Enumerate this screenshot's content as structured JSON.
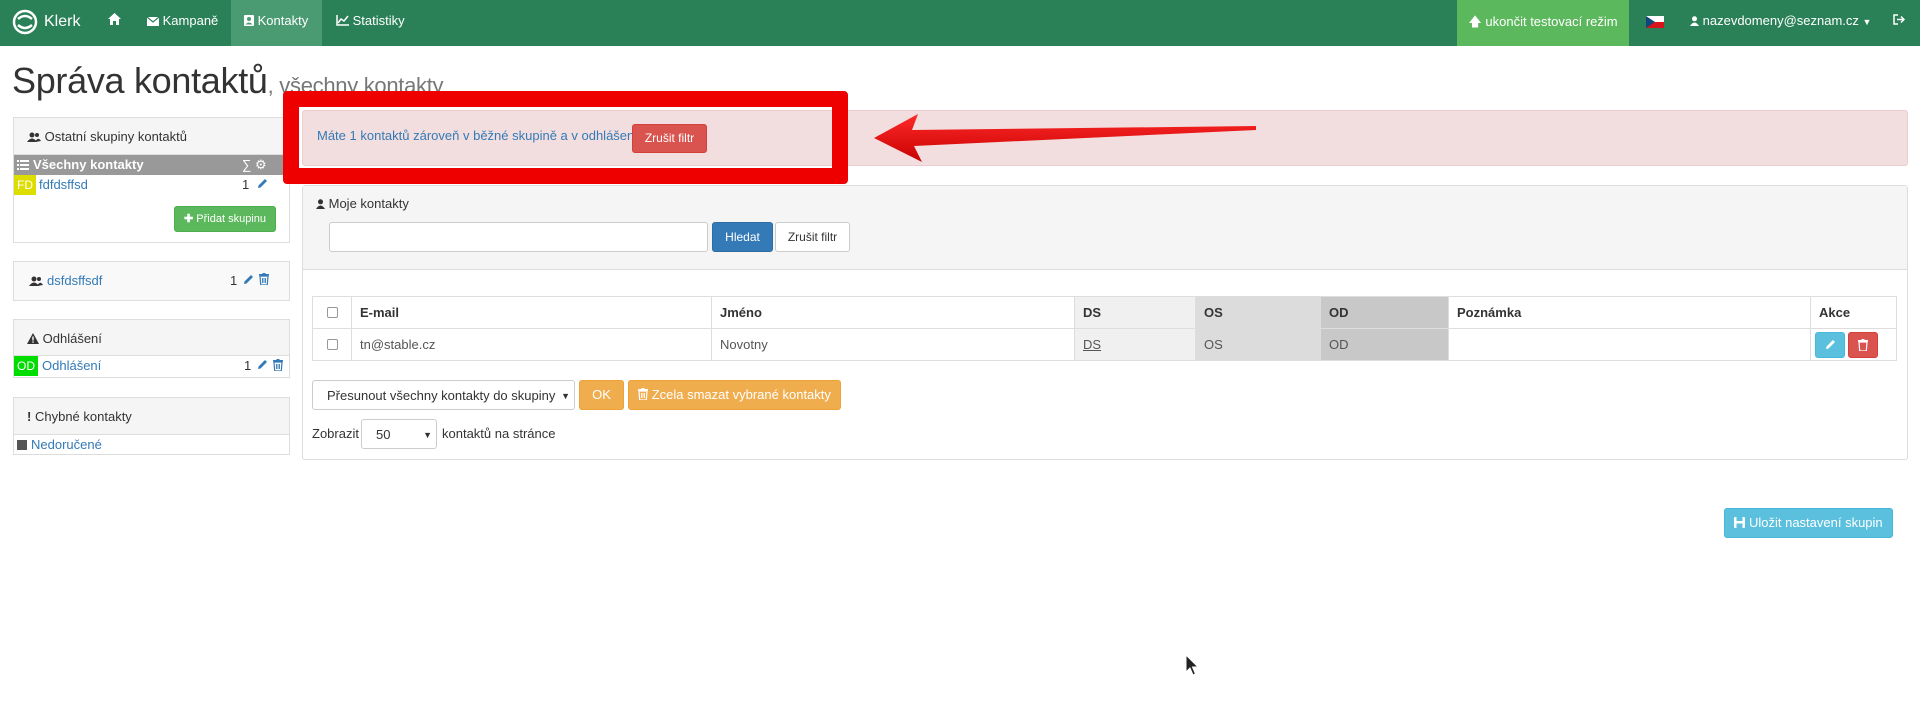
{
  "navbar": {
    "brand": "Klerk",
    "home_icon": "home-icon",
    "items": [
      {
        "label": "Kampaně",
        "icon": "envelope-icon"
      },
      {
        "label": "Kontakty",
        "icon": "address-book-icon",
        "active": true
      },
      {
        "label": "Statistiky",
        "icon": "line-chart-icon"
      }
    ],
    "test_mode_label": "ukončit testovací režim",
    "user_email": "nazevdomeny@seznam.cz",
    "colors": {
      "navbar": "#2a8057",
      "active": "#4a9a72",
      "test": "#5cb85c"
    }
  },
  "page": {
    "title": "Správa kontaktů",
    "subtitle": ", všechny kontakty"
  },
  "sidebar": {
    "other_groups": {
      "title": "Ostatní skupiny kontaktů",
      "all_label": "Všechny kontakty",
      "sum_symbol": "∑",
      "groups": [
        {
          "tag": "FD",
          "name": "fdfdsffsd",
          "count": "1"
        }
      ],
      "add_button": "Přidat skupinu"
    },
    "group_box": {
      "name": "dsfdsffsdf",
      "count": "1"
    },
    "unsubscribe": {
      "title": "Odhlášení",
      "groups": [
        {
          "tag": "OD",
          "name": "Odhlášení",
          "count": "1"
        }
      ]
    },
    "bad_contacts": {
      "title": "Chybné kontakty",
      "items": [
        {
          "name": "Nedoručené"
        }
      ]
    }
  },
  "alert": {
    "text": "Máte 1 kontaktů zároveň v běžné skupině a v odhlášení",
    "button": "Zrušit filtr"
  },
  "contacts": {
    "title": "Moje kontakty",
    "search_value": "",
    "search_button": "Hledat",
    "reset_button": "Zrušit filtr",
    "columns": [
      "E-mail",
      "Jméno",
      "DS",
      "OS",
      "OD",
      "Poznámka",
      "Akce"
    ],
    "rows": [
      {
        "email": "tn@stable.cz",
        "name": "Novotny",
        "ds": "DS",
        "os": "OS",
        "od": "OD",
        "note": ""
      }
    ],
    "move_select": "Přesunout všechny kontakty do skupiny",
    "ok_button": "OK",
    "delete_button": "Zcela smazat vybrané kontakty",
    "show_label": "Zobrazit",
    "per_page": "50",
    "per_page_suffix": "kontaktů na stránce"
  },
  "save_button": "Uložit nastavení skupin"
}
